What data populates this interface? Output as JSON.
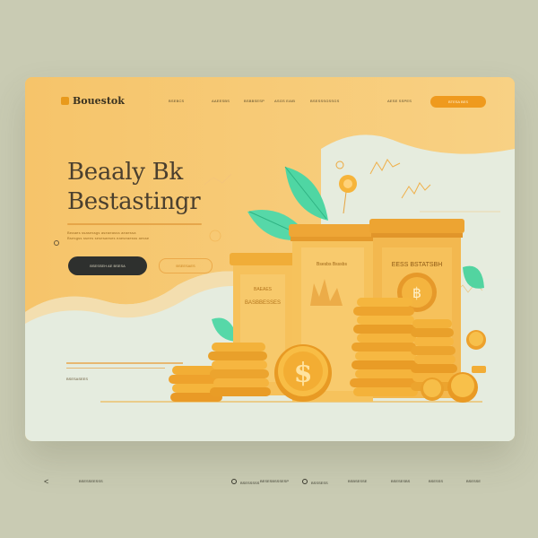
{
  "nav": {
    "logo_text": "Bouestok",
    "links": [
      "Bsebcs",
      "Aaeesbs",
      "Bsbbsesp",
      "Asgs eaib",
      "Bsesssgssgs",
      "Aese sspes"
    ],
    "cta_label": "Btesa bes"
  },
  "hero": {
    "title_line1": "Beaaly Bk",
    "title_line2": "Bestastingr",
    "desc_lines": [
      "Beaaes ssasessgs aseaeasss aeaessa",
      "Bsesgss ssees sesesaeses eaeseaesss aesse"
    ],
    "primary_button": "Bsesseh  ae  Bsesa",
    "secondary_button": "Bseesaes"
  },
  "illustration": {
    "jar_left_label": "Baeaes Basbbesses",
    "jar_center_label": "Bsesbs Bsssbs",
    "jar_right_label": "EESS BSTATSBH",
    "coin_symbol": "$",
    "coin_symbol_alt": "฿",
    "colors": {
      "gold": "#f3b33c",
      "gold_dark": "#d98a1c",
      "leaf": "#4fd6a3",
      "mint_bg": "#e5ecdf"
    }
  },
  "lower": {
    "label": "Bsesasees"
  },
  "footer": {
    "arrow": "<",
    "brand": "Bsesseesss",
    "links": [
      "Bsesssss",
      "Besesbsssesp",
      "Bsssess",
      "Bsbsesse",
      "Bsesesbs",
      "Bsesss",
      "Bsesse"
    ]
  },
  "theme": {
    "background": "#c9cbb3",
    "card_orange": "#f3c56f",
    "accent": "#ef9a1e",
    "dark_button": "#2e302e"
  }
}
